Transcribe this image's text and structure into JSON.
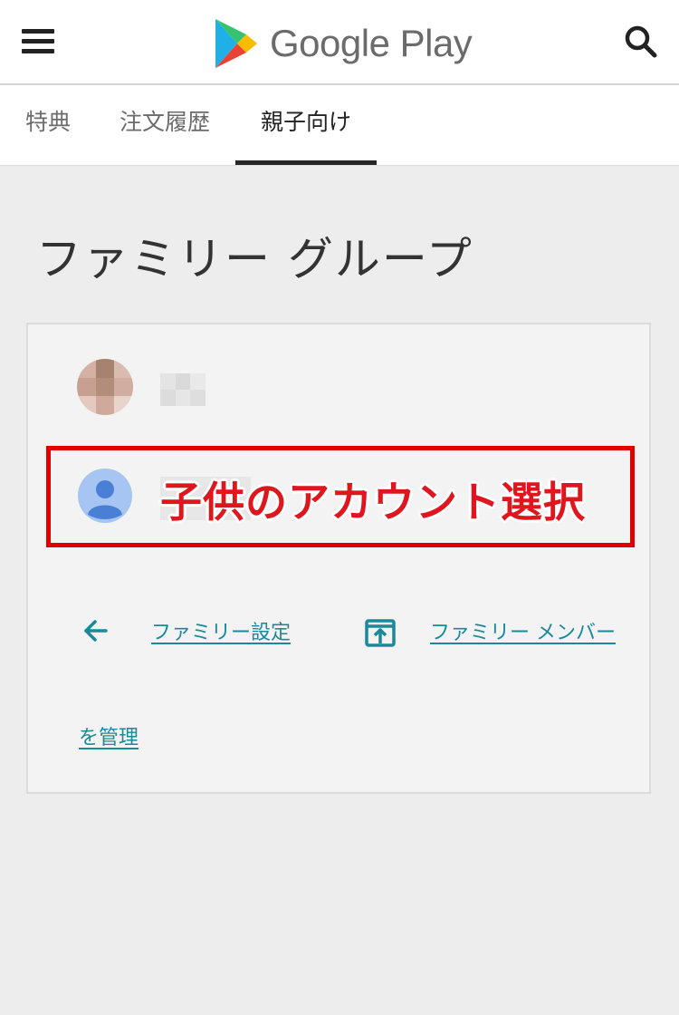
{
  "header": {
    "logo_text": "Google Play",
    "menu_icon": "menu-icon",
    "search_icon": "search-icon"
  },
  "tabs": [
    {
      "label": "特典",
      "active": false
    },
    {
      "label": "注文履歴",
      "active": false
    },
    {
      "label": "親子向け",
      "active": true
    }
  ],
  "page": {
    "title": "ファミリー グループ"
  },
  "card": {
    "annotation": "子供のアカウント選択",
    "links": {
      "family_settings": "ファミリー設定",
      "family_members_line1": "ファミリー メンバー",
      "family_members_line2": "を管理"
    }
  },
  "colors": {
    "accent_link": "#1a8a9b",
    "annotation_red": "#e10000",
    "avatar_blue": "#4a7fd6"
  }
}
